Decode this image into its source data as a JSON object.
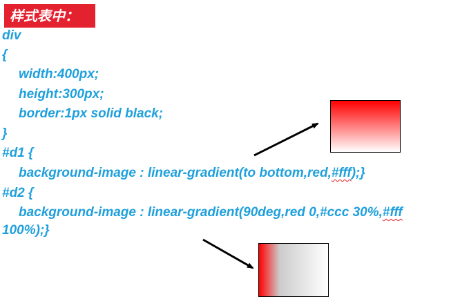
{
  "header": {
    "title": "样式表中："
  },
  "code": {
    "line1": "div",
    "line2": "{",
    "line3": "width:400px;",
    "line4": "height:300px;",
    "line5": "border:1px solid black;",
    "line6": "}",
    "line7": "#d1 {",
    "line8_pre": "background-image : linear-gradient(to bottom,red,",
    "line8_squiggle": "#fff",
    "line8_post": ");}",
    "line9": "#d2 {",
    "line10_pre": "background-image : linear-gradient(90deg,red 0,#ccc 30%,",
    "line10_squiggle": "#fff",
    "line11": "100%);}"
  },
  "demos": {
    "d1": {
      "gradient": "linear-gradient(to bottom, red, #fff)"
    },
    "d2": {
      "gradient": "linear-gradient(90deg, red 0, #ccc 30%, #fff 100%)"
    }
  },
  "colors": {
    "badge_bg": "#e4212f",
    "code_text": "#1fa0dc",
    "squiggle": "#e0202a",
    "arrow": "#000000"
  }
}
